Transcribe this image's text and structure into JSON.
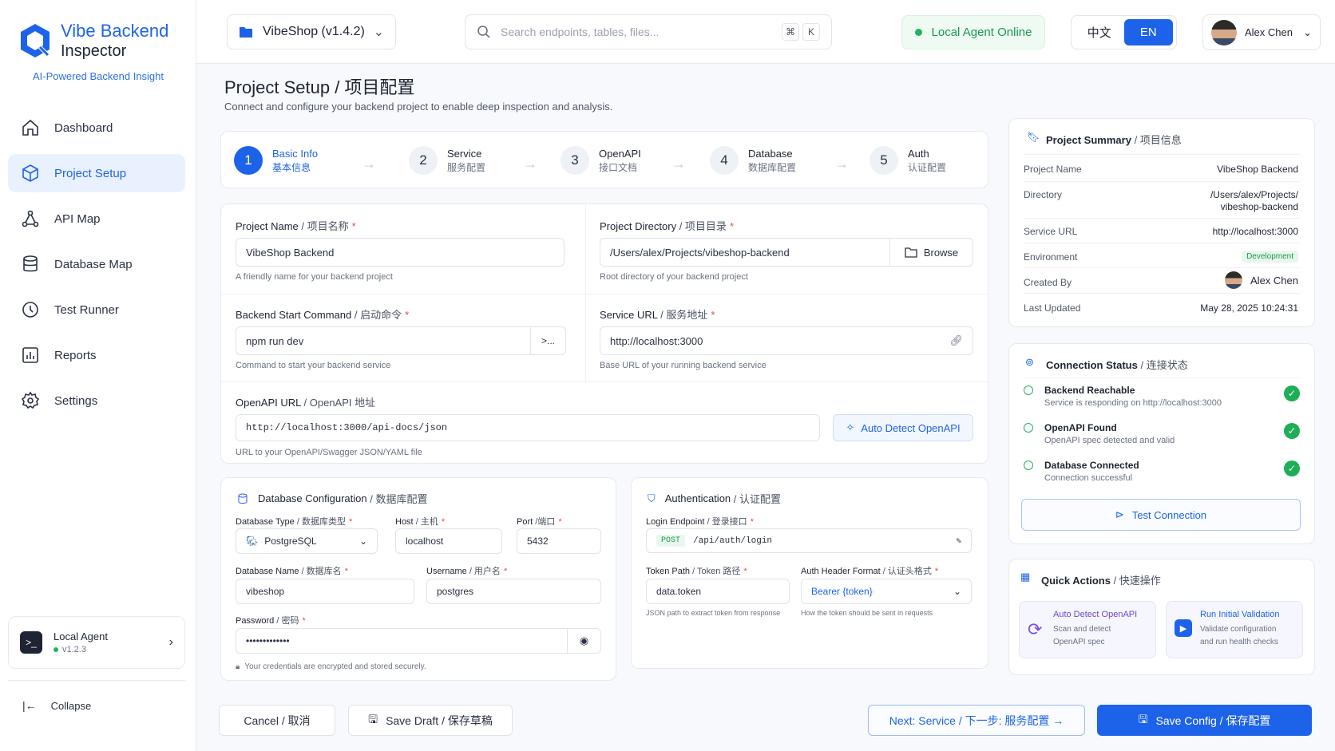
{
  "app": {
    "title": "Vibe Backend",
    "subtitle": "Inspector",
    "tagline": "AI-Powered Backend Insight"
  },
  "nav": [
    {
      "label": "Dashboard",
      "icon": "home-icon"
    },
    {
      "label": "Project Setup",
      "icon": "cube-icon"
    },
    {
      "label": "API Map",
      "icon": "nodes-icon"
    },
    {
      "label": "Database Map",
      "icon": "database-icon"
    },
    {
      "label": "Test Runner",
      "icon": "clock-icon"
    },
    {
      "label": "Reports",
      "icon": "chart-icon"
    },
    {
      "label": "Settings",
      "icon": "gear-icon"
    }
  ],
  "agent": {
    "name": "Local Agent",
    "version": "v1.2.3"
  },
  "collapse_label": "Collapse",
  "topbar": {
    "project": "VibeShop (v1.4.2)",
    "search_placeholder": "Search endpoints, tables, files...",
    "shortcut_1": "⌘",
    "shortcut_2": "K",
    "agent_status": "Local Agent Online",
    "lang_zh": "中文",
    "lang_en": "EN",
    "user": "Alex Chen"
  },
  "page": {
    "title": "Project Setup",
    "title_cn": "/ 项目配置",
    "description": "Connect and configure your backend project to enable deep inspection and analysis."
  },
  "steps": [
    {
      "num": "1",
      "en": "Basic Info",
      "zh": "基本信息"
    },
    {
      "num": "2",
      "en": "Service",
      "zh": "服务配置"
    },
    {
      "num": "3",
      "en": "OpenAPI",
      "zh": "接口文档"
    },
    {
      "num": "4",
      "en": "Database",
      "zh": "数据库配置"
    },
    {
      "num": "5",
      "en": "Auth",
      "zh": "认证配置"
    }
  ],
  "form": {
    "project_name": {
      "label": "Project Name",
      "cn": "/ 项目名称",
      "value": "VibeShop Backend",
      "hint": "A friendly name for your backend project"
    },
    "project_dir": {
      "label": "Project Directory",
      "cn": "/ 项目目录",
      "value": "/Users/alex/Projects/vibeshop-backend",
      "hint": "Root directory of your backend project",
      "browse": "Browse"
    },
    "start_cmd": {
      "label": "Backend Start Command",
      "cn": "/ 启动命令",
      "value": "npm run dev",
      "hint": "Command to start your backend service",
      "run": ">..."
    },
    "service_url": {
      "label": "Service URL",
      "cn": "/ 服务地址",
      "value": "http://localhost:3000",
      "hint": "Base URL of your running backend service"
    },
    "openapi_url": {
      "label": "OpenAPI URL",
      "cn": "/ OpenAPI 地址",
      "value": "http://localhost:3000/api-docs/json",
      "hint": "URL to your OpenAPI/Swagger JSON/YAML file",
      "detect": "Auto Detect OpenAPI"
    }
  },
  "database": {
    "title": "Database Configuration",
    "title_cn": "/ 数据库配置",
    "type_label": "Database Type",
    "type_cn": "/ 数据库类型",
    "type_value": "PostgreSQL",
    "host_label": "Host",
    "host_cn": "/ 主机",
    "host_value": "localhost",
    "port_label": "Port",
    "port_cn": "/端口",
    "port_value": "5432",
    "name_label": "Database Name",
    "name_cn": "/ 数据库名",
    "name_value": "vibeshop",
    "user_label": "Username",
    "user_cn": "/ 用户名",
    "user_value": "postgres",
    "pass_label": "Password",
    "pass_cn": "/ 密码",
    "pass_value": "•••••••••••••",
    "secure_note": "Your credentials are encrypted and stored securely."
  },
  "auth": {
    "title": "Authentication",
    "title_cn": "/ 认证配置",
    "login_label": "Login Endpoint",
    "login_cn": "/ 登录接口",
    "method": "POST",
    "login_value": "/api/auth/login",
    "token_label": "Token Path",
    "token_cn": "/ Token 路径",
    "token_value": "data.token",
    "token_hint": "JSON path to extract token from response",
    "header_label": "Auth Header Format",
    "header_cn": "/ 认证头格式",
    "header_value": "Bearer {token}",
    "header_hint": "How the token should be sent in requests"
  },
  "summary": {
    "title": "Project Summary",
    "title_cn": "/ 项目信息",
    "rows": [
      {
        "label": "Project Name",
        "value": "VibeShop Backend"
      },
      {
        "label": "Directory",
        "value": "/Users/alex/Projects/",
        "value2": "vibeshop-backend"
      },
      {
        "label": "Service URL",
        "value": "http://localhost:3000"
      },
      {
        "label": "Environment",
        "value": "Development"
      },
      {
        "label": "Created By",
        "value": "Alex Chen"
      },
      {
        "label": "Last Updated",
        "value": "May 28, 2025 10:24:31"
      }
    ]
  },
  "connection": {
    "title": "Connection Status",
    "title_cn": "/ 连接状态",
    "items": [
      {
        "title": "Backend Reachable",
        "desc": "Service is responding on http://localhost:3000"
      },
      {
        "title": "OpenAPI Found",
        "desc": "OpenAPI spec detected and valid"
      },
      {
        "title": "Database Connected",
        "desc": "Connection successful"
      }
    ],
    "test_button": "Test Connection"
  },
  "quick": {
    "title": "Quick Actions",
    "title_cn": "/ 快速操作",
    "a1_title": "Auto Detect OpenAPI",
    "a1_desc1": "Scan and detect",
    "a1_desc2": "OpenAPI spec",
    "a2_title": "Run Initial Validation",
    "a2_desc1": "Validate configuration",
    "a2_desc2": "and run health checks"
  },
  "footer": {
    "cancel": "Cancel / 取消",
    "draft": "Save Draft  /  保存草稿",
    "next": "Next: Service  /  下一步: 服务配置  →",
    "save": "Save Config  /  保存配置"
  },
  "colors": {
    "accent": "#1d63ea",
    "success": "#1fae58",
    "danger": "#e5484d"
  }
}
